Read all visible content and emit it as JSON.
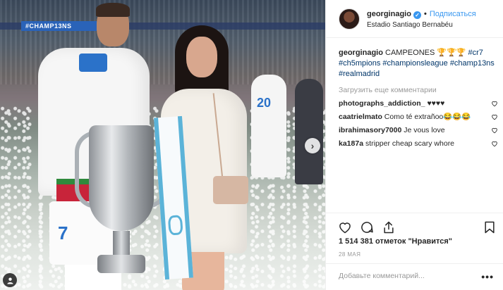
{
  "header": {
    "username": "georginagio",
    "follow_label": "Подписаться",
    "location": "Estadio Santiago Bernabéu"
  },
  "photo": {
    "banner_text": "#CHAMP13NS",
    "jersey_number": "7",
    "bg_jersey_number": "20"
  },
  "caption": {
    "username": "georginagio",
    "text": "CAMPEONES 🏆🏆🏆",
    "hashtags": [
      "#cr7",
      "#ch5mpions",
      "#championsleague",
      "#champ13ns",
      "#realmadrid"
    ]
  },
  "load_more_label": "Загрузить еще комментарии",
  "comments": [
    {
      "user": "photographs_addiction_",
      "text": "♥♥♥♥"
    },
    {
      "user": "caatrielmato",
      "text": "Como té extrañoo😂😂😂"
    },
    {
      "user": "ibrahimasory7000",
      "text": "Je vous love"
    },
    {
      "user": "ka187a",
      "text": "stripper cheap scary whore"
    }
  ],
  "actions": {
    "icons": [
      "heart-icon",
      "comment-icon",
      "share-icon",
      "bookmark-icon"
    ]
  },
  "likes_text": "1 514 381 отметок \"Нравится\"",
  "date_text": "28 МАЯ",
  "add_comment": {
    "placeholder": "Добавьте комментарий...",
    "more_label": "•••"
  },
  "colors": {
    "link": "#3897f0",
    "hashtag": "#003569",
    "muted": "#999999",
    "text": "#262626"
  }
}
